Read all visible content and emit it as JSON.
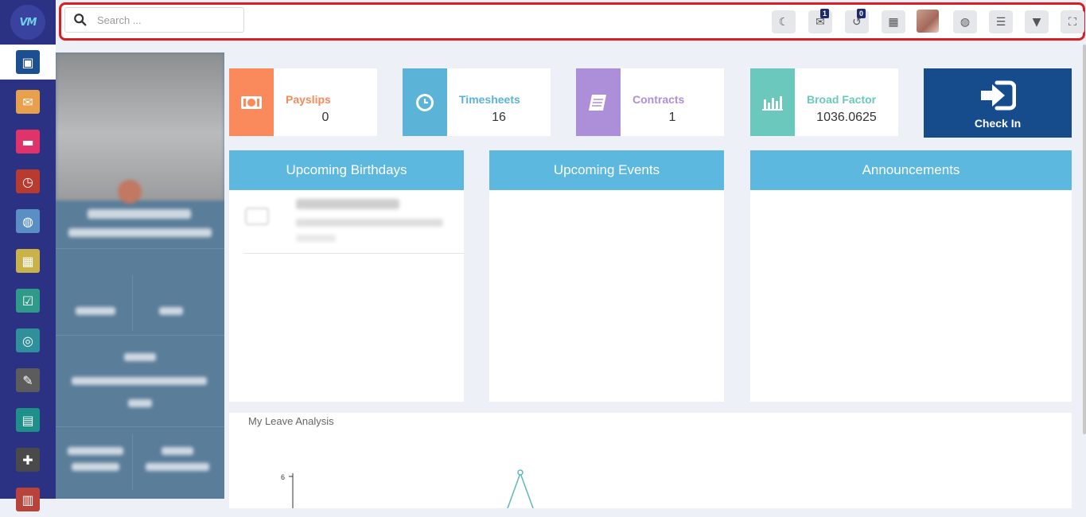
{
  "logo": {
    "text": "VM"
  },
  "sidebar": {
    "items": [
      {
        "name": "dashboard",
        "icon": "monitor-icon",
        "bg": "#1b4f8f",
        "glyph": "▣",
        "active": true
      },
      {
        "name": "mail",
        "icon": "envelope-icon",
        "bg": "#e8a04d",
        "glyph": "✉"
      },
      {
        "name": "chat",
        "icon": "chat-bubble-icon",
        "bg": "#e0336a",
        "glyph": "▬"
      },
      {
        "name": "timer",
        "icon": "stopwatch-icon",
        "bg": "#b93a2f",
        "glyph": "◷"
      },
      {
        "name": "users-time",
        "icon": "user-clock-icon",
        "bg": "#5a8fc4",
        "glyph": "◍"
      },
      {
        "name": "calendar",
        "icon": "calendar-icon",
        "bg": "#c9b24a",
        "glyph": "▦"
      },
      {
        "name": "tasks",
        "icon": "checklist-icon",
        "bg": "#2f9a8a",
        "glyph": "☑"
      },
      {
        "name": "performance",
        "icon": "gauge-icon",
        "bg": "#2f8f9a",
        "glyph": "◎"
      },
      {
        "name": "notes",
        "icon": "note-edit-icon",
        "bg": "#5c5c5c",
        "glyph": "✎"
      },
      {
        "name": "contacts",
        "icon": "contact-card-icon",
        "bg": "#1f8f8a",
        "glyph": "▤"
      },
      {
        "name": "modules",
        "icon": "puzzle-icon",
        "bg": "#4a4a4a",
        "glyph": "✚"
      },
      {
        "name": "more",
        "icon": "box-icon",
        "bg": "#b8433a",
        "glyph": "▥"
      }
    ]
  },
  "topbar": {
    "search_placeholder": "Search ...",
    "buttons": [
      {
        "name": "dark-mode-button",
        "icon": "moon-icon",
        "glyph": "☾"
      },
      {
        "name": "messages-button",
        "icon": "chat-icon",
        "glyph": "✉",
        "badge": "1"
      },
      {
        "name": "notifications-button",
        "icon": "history-icon",
        "glyph": "↺",
        "badge": "0"
      },
      {
        "name": "calculator-button",
        "icon": "calculator-icon",
        "glyph": "▦"
      },
      {
        "name": "language-button",
        "icon": "globe-icon",
        "glyph": "◍"
      },
      {
        "name": "menu-button",
        "icon": "hamburger-icon",
        "glyph": "☰"
      },
      {
        "name": "bookmark-button",
        "icon": "bookmark-icon",
        "glyph": "▼"
      },
      {
        "name": "fullscreen-button",
        "icon": "fullscreen-icon",
        "glyph": "⛶"
      }
    ]
  },
  "stats": [
    {
      "label": "Payslips",
      "value": "0",
      "color": "#fa8a5c",
      "icon": "money-icon"
    },
    {
      "label": "Timesheets",
      "value": "16",
      "color": "#5cb3d8",
      "icon": "clock-icon"
    },
    {
      "label": "Contracts",
      "value": "1",
      "color": "#ad8fd9",
      "icon": "document-icon"
    },
    {
      "label": "Broad Factor",
      "value": "1036.0625",
      "color": "#6ac9bc",
      "icon": "bar-chart-icon"
    }
  ],
  "checkin": {
    "label": "Check In",
    "icon": "sign-in-icon"
  },
  "panels": {
    "birthdays": "Upcoming Birthdays",
    "events": "Upcoming Events",
    "announcements": "Announcements"
  },
  "leave": {
    "title": "My Leave Analysis",
    "y_tick": "6"
  }
}
